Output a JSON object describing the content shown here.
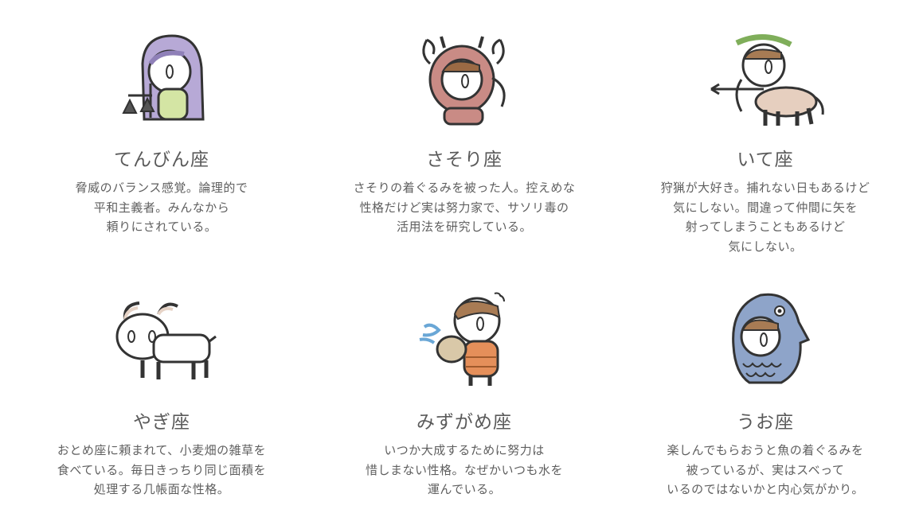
{
  "signs": [
    {
      "illustration_icon": "libra-character-icon",
      "title": "てんびん座",
      "desc": [
        "脅威のバランス感覚。論理的で",
        "平和主義者。みんなから",
        "頼りにされている。"
      ]
    },
    {
      "illustration_icon": "scorpio-character-icon",
      "title": "さそり座",
      "desc": [
        "さそりの着ぐるみを被った人。控えめな",
        "性格だけど実は努力家で、サソリ毒の",
        "活用法を研究している。"
      ]
    },
    {
      "illustration_icon": "sagittarius-character-icon",
      "title": "いて座",
      "desc": [
        "狩猟が大好き。捕れない日もあるけど",
        "気にしない。間違って仲間に矢を",
        "射ってしまうこともあるけど",
        "気にしない。"
      ]
    },
    {
      "illustration_icon": "capricorn-character-icon",
      "title": "やぎ座",
      "desc": [
        "おとめ座に頼まれて、小麦畑の雑草を",
        "食べている。毎日きっちり同じ面積を",
        "処理する几帳面な性格。"
      ]
    },
    {
      "illustration_icon": "aquarius-character-icon",
      "title": "みずがめ座",
      "desc": [
        "いつか大成するために努力は",
        "惜しまない性格。なぜかいつも水を",
        "運んでいる。"
      ]
    },
    {
      "illustration_icon": "pisces-character-icon",
      "title": "うお座",
      "desc": [
        "楽しんでもらおうと魚の着ぐるみを",
        "被っているが、実はスベって",
        "いるのではないかと内心気がかり。"
      ]
    }
  ]
}
